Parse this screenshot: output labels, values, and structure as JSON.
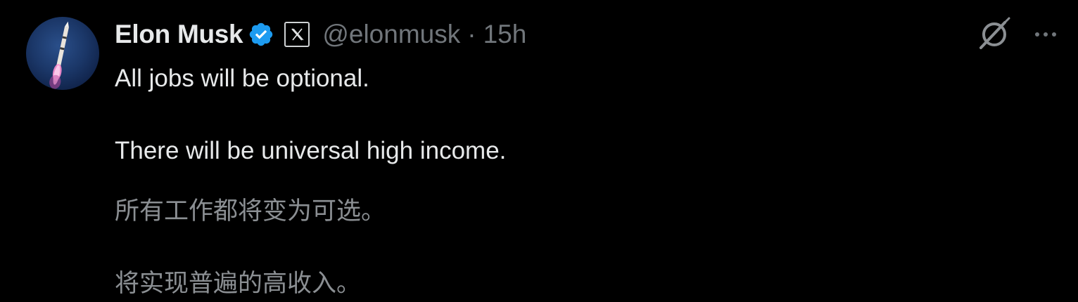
{
  "author": {
    "display_name": "Elon Musk",
    "handle": "@elonmusk",
    "separator": "·",
    "timestamp": "15h",
    "verified": true,
    "affiliation_icon": "x-logo-icon",
    "avatar": "rocket-launch-avatar"
  },
  "tweet": {
    "lines": [
      "All jobs will be optional.",
      "There will be universal high income."
    ],
    "translation": [
      "所有工作都将变为可选。",
      "将实现普遍的高收入。"
    ]
  },
  "actions": {
    "grok_icon": "grok-icon",
    "more_icon": "more-options-icon"
  },
  "colors": {
    "background": "#000000",
    "primary_text": "#e7e9ea",
    "secondary_text": "#71767b",
    "verified_blue": "#1d9bf0"
  }
}
